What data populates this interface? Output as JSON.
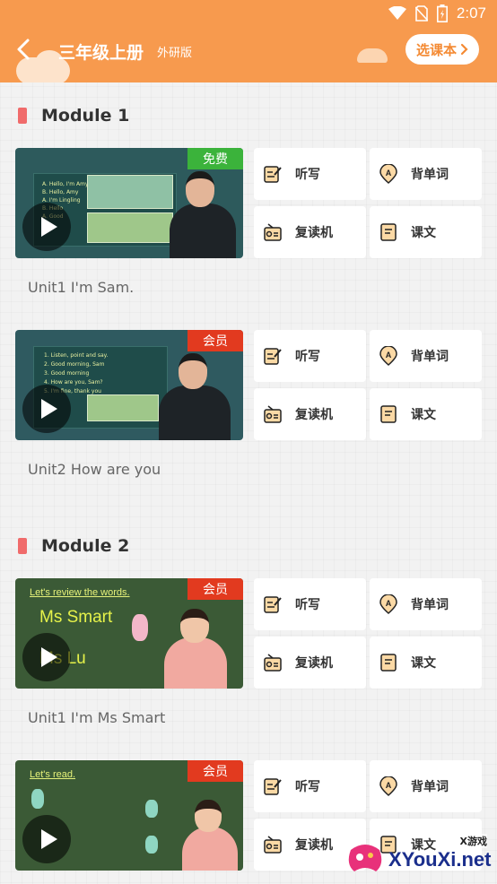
{
  "status": {
    "time": "2:07"
  },
  "header": {
    "title": "三年级上册",
    "subtitle": "外研版",
    "select_label": "选课本"
  },
  "actions": {
    "dictation": "听写",
    "vocab": "背单词",
    "repeater": "复读机",
    "text": "课文"
  },
  "modules": [
    {
      "title": "Module 1"
    },
    {
      "title": "Module 2"
    }
  ],
  "lessons": [
    {
      "title": "Unit1 I'm Sam.",
      "badge": "免费",
      "badge_color": "#3bb33b",
      "board_text": [
        "A. Hello, I'm Amy",
        "B. Hello, Amy",
        "A. I'm Lingling",
        "B. Hello",
        "A. Good"
      ]
    },
    {
      "title": "Unit2 How are you",
      "badge": "会员",
      "badge_color": "#e23a1f",
      "board_text": [
        "1. Listen, point and say.",
        "2. Good morning, Sam",
        "3. Good morning",
        "4. How are you, Sam?",
        "5. I'm fine, thank you"
      ]
    },
    {
      "title": "Unit1 I'm Ms Smart",
      "badge": "会员",
      "badge_color": "#e23a1f",
      "board_heading": "Let's review the words.",
      "board_line1": "Ms Smart",
      "board_line2": "Ms Lu"
    },
    {
      "title": "",
      "badge": "会员",
      "badge_color": "#e23a1f",
      "board_heading": "Let's read."
    }
  ],
  "watermark": {
    "brand": "XYouXi.net",
    "tag": "X游戏"
  }
}
